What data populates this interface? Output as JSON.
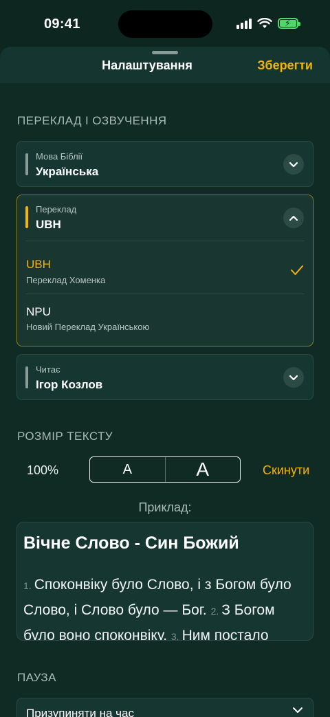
{
  "status": {
    "time": "09:41"
  },
  "header": {
    "title": "Налаштування",
    "save": "Зберегти"
  },
  "translation_section": {
    "label": "ПЕРЕКЛАД І ОЗВУЧЕННЯ",
    "bible_language": {
      "caption": "Мова Біблії",
      "value": "Українська"
    },
    "translation": {
      "caption": "Переклад",
      "value": "UBH",
      "options": [
        {
          "code": "UBH",
          "name": "Переклад Хоменка",
          "selected": true
        },
        {
          "code": "NPU",
          "name": "Новий Переклад Українською",
          "selected": false
        }
      ]
    },
    "reader": {
      "caption": "Читає",
      "value": "Ігор Козлов"
    }
  },
  "text_size": {
    "label": "РОЗМІР ТЕКСТУ",
    "percent": "100%",
    "decrease": "A",
    "increase": "A",
    "reset": "Скинути"
  },
  "example": {
    "label": "Приклад:",
    "title": "Вічне Слово - Син Божий",
    "verses": [
      {
        "num": "1.",
        "text": "Споконвіку було Слово, і з Богом було Слово, і Слово було — Бог."
      },
      {
        "num": "2.",
        "text": "З Богом було воно споконвіку."
      },
      {
        "num": "3.",
        "text": "Ним постало"
      }
    ]
  },
  "pause": {
    "label": "ПАУЗА",
    "value": "Призупиняти на час"
  },
  "colors": {
    "accent": "#f4b400",
    "background": "#0f2b24",
    "field": "#163631"
  }
}
